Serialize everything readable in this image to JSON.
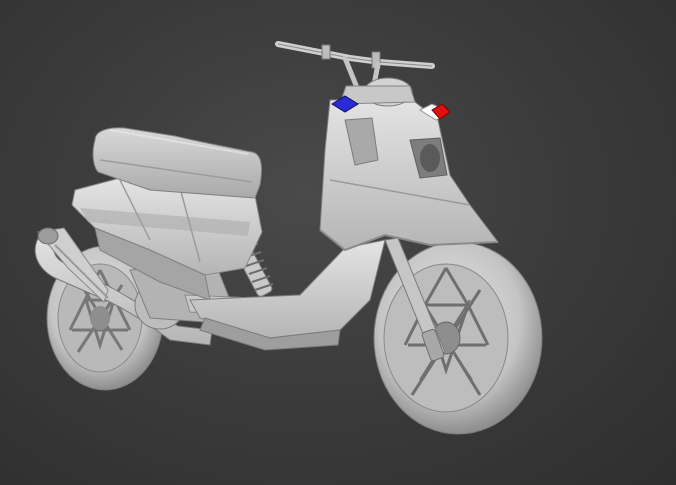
{
  "scene": {
    "subject": "scooter-3d-model",
    "colors": {
      "background": "#3c3c3c",
      "model_body": "#d2d2d2",
      "model_shadow": "#9a9a9a",
      "model_dark": "#7a7a7a",
      "indicator_left": "#2a2ad8",
      "indicator_right": "#e01010"
    }
  }
}
